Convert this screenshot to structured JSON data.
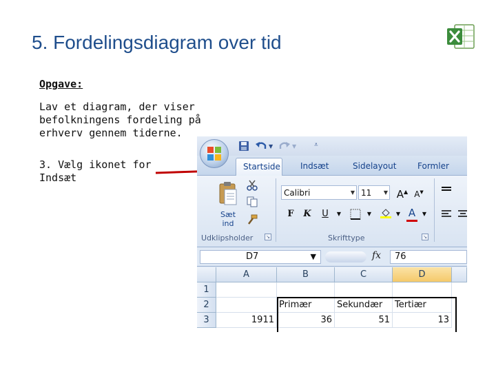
{
  "slide": {
    "title": "5. Fordelingsdiagram over tid",
    "task_label": "Opgave:",
    "task_text": "Lav et diagram, der viser befolkningens fordeling på erhverv gennem tiderne.",
    "step_text": "3. Vælg ikonet for Indsæt"
  },
  "ribbon": {
    "tabs": [
      "Startside",
      "Indsæt",
      "Sidelayout",
      "Formler"
    ],
    "active_tab": "Startside",
    "groups": {
      "clipboard": "Udklipsholder",
      "font": "Skrifttype"
    },
    "paste_label": "Sæt ind",
    "font_name": "Calibri",
    "font_size": "11",
    "bold": "F",
    "italic": "K",
    "underline": "U"
  },
  "formula_bar": {
    "cell_ref": "D7",
    "fx": "fx",
    "value": "76"
  },
  "sheet": {
    "columns": [
      "A",
      "B",
      "C",
      "D"
    ],
    "rows": [
      "1",
      "2",
      "3"
    ],
    "row2": [
      "",
      "Primær",
      "Sekundær",
      "Tertiær"
    ],
    "row3": [
      "1911",
      "36",
      "51",
      "13"
    ]
  },
  "colors": {
    "title": "#1f4e8c",
    "arrow": "#c00000",
    "ribbon_text": "#15428b"
  }
}
